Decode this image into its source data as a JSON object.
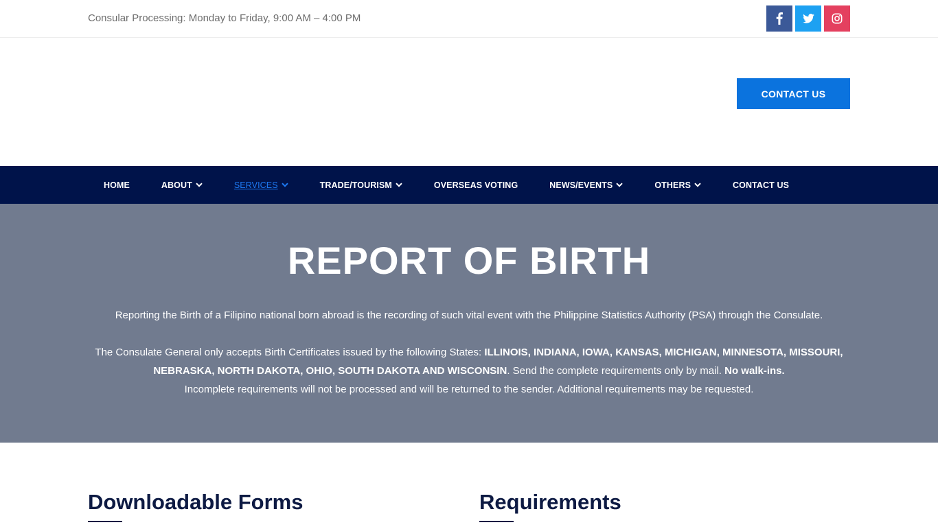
{
  "topbar": {
    "hours": "Consular Processing: Monday to Friday, 9:00 AM – 4:00 PM"
  },
  "social": {
    "facebook_icon": "facebook-icon",
    "twitter_icon": "twitter-icon",
    "instagram_icon": "instagram-icon",
    "colors": {
      "facebook": "#3b5998",
      "twitter": "#1da1f2",
      "instagram": "#e4405f"
    }
  },
  "header": {
    "contact_label": "CONTACT US",
    "accent": "#0b73de"
  },
  "nav": {
    "items": [
      {
        "label": "HOME"
      },
      {
        "label": "ABOUT"
      },
      {
        "label": "SERVICES"
      },
      {
        "label": "TRADE/TOURISM"
      },
      {
        "label": "OVERSEAS VOTING"
      },
      {
        "label": "NEWS/EVENTS"
      },
      {
        "label": "OTHERS"
      },
      {
        "label": "CONTACT US"
      }
    ],
    "background": "#00134a"
  },
  "hero": {
    "title": "REPORT OF BIRTH",
    "intro": "Reporting the Birth of a Filipino national born abroad is the recording of such vital event with the Philippine Statistics Authority (PSA) through the Consulate.",
    "states_lead": "The Consulate General only accepts Birth Certificates issued by the following States: ",
    "states": "ILLINOIS, INDIANA, IOWA, KANSAS, MICHIGAN, MINNESOTA, MISSOURI, NEBRASKA, NORTH DAKOTA, OHIO, SOUTH DAKOTA AND WISCONSIN",
    "mail_note": ". Send the complete requirements only by mail. ",
    "no_walkins": "No walk-ins.",
    "incomplete_note": "Incomplete requirements will not be processed and will be returned to the sender. Additional requirements may be requested.",
    "background": "#717b8f"
  },
  "sections": {
    "forms_title": "Downloadable Forms",
    "requirements_title": "Requirements"
  }
}
